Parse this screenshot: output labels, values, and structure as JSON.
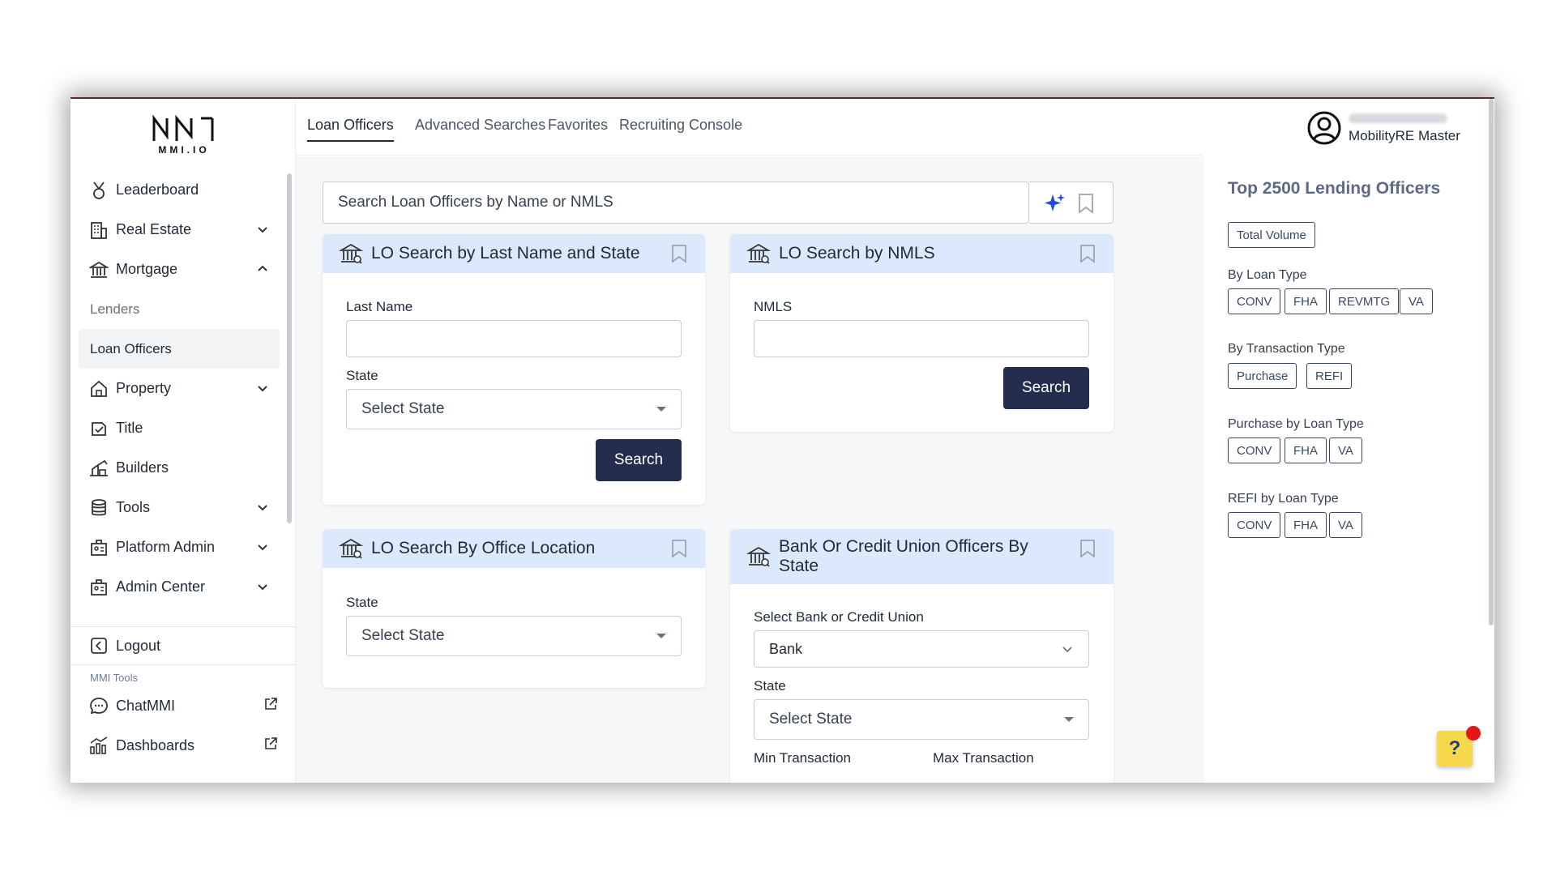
{
  "brand": {
    "logo_text": "MMI.IO"
  },
  "sidebar": {
    "items": [
      {
        "label": "Leaderboard",
        "icon": "medal-icon"
      },
      {
        "label": "Real Estate",
        "icon": "building-icon",
        "expandable": true
      },
      {
        "label": "Mortgage",
        "icon": "bank-icon",
        "expandable": true,
        "expanded": true
      },
      {
        "label": "Lenders",
        "sub": true
      },
      {
        "label": "Loan Officers",
        "sub": true,
        "active": true
      },
      {
        "label": "Property",
        "icon": "house-icon",
        "expandable": true
      },
      {
        "label": "Title",
        "icon": "title-icon"
      },
      {
        "label": "Builders",
        "icon": "builders-icon"
      },
      {
        "label": "Tools",
        "icon": "database-icon",
        "expandable": true
      },
      {
        "label": "Platform Admin",
        "icon": "admin-icon",
        "expandable": true
      },
      {
        "label": "Admin Center",
        "icon": "admin-center-icon",
        "expandable": true
      }
    ],
    "logout": "Logout",
    "mmi_tools_label": "MMI Tools",
    "chatmmi": "ChatMMI",
    "dashboards": "Dashboards"
  },
  "topnav": {
    "tabs": [
      "Loan Officers",
      "Advanced Searches",
      "Favorites",
      "Recruiting Console"
    ],
    "active_tab": "Loan Officers",
    "user_name": "MobilityRE Master"
  },
  "search": {
    "placeholder": "Search Loan Officers by Name or NMLS"
  },
  "cards": {
    "last_name_state": {
      "title": "LO Search by Last Name and State",
      "last_name_label": "Last Name",
      "state_label": "State",
      "state_value": "Select State",
      "button": "Search"
    },
    "nmls": {
      "title": "LO Search by NMLS",
      "nmls_label": "NMLS",
      "button": "Search"
    },
    "office_location": {
      "title": "LO Search By Office Location",
      "state_label": "State",
      "state_value": "Select State"
    },
    "bank_cu": {
      "title_line1": "Bank Or Credit Union Officers By",
      "title_line2": "State",
      "type_label": "Select Bank or Credit Union",
      "type_value": "Bank",
      "state_label": "State",
      "state_value": "Select State",
      "min_label": "Min Transaction",
      "max_label": "Max Transaction"
    }
  },
  "right_panel": {
    "title": "Top 2500 Lending Officers",
    "total_volume": "Total Volume",
    "by_loan_type_label": "By Loan Type",
    "by_loan_type": [
      "CONV",
      "FHA",
      "REVMTG",
      "VA"
    ],
    "by_transaction_label": "By Transaction Type",
    "by_transaction": [
      "Purchase",
      "REFI"
    ],
    "purchase_label": "Purchase by Loan Type",
    "purchase": [
      "CONV",
      "FHA",
      "VA"
    ],
    "refi_label": "REFI by Loan Type",
    "refi": [
      "CONV",
      "FHA",
      "VA"
    ]
  },
  "help": {
    "label": "?"
  },
  "colors": {
    "accent_dark": "#252d4e",
    "card_header": "#dce8fb",
    "sparkle": "#1e4fd8",
    "help_bg": "#f7d84a",
    "notify_dot": "#e51616"
  }
}
